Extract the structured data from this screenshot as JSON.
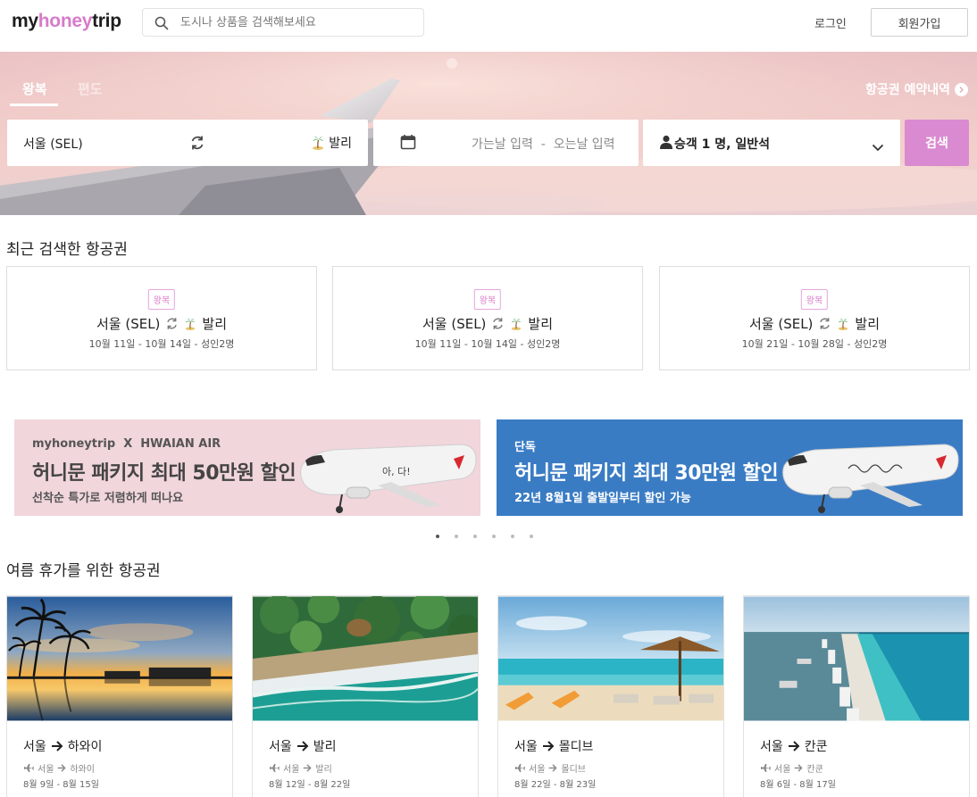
{
  "header": {
    "logo_my": "my",
    "logo_honey": "honey",
    "logo_trip": "trip",
    "search_placeholder": "도시나 상품을 검색해보세요",
    "login_label": "로그인",
    "signup_label": "회원가입"
  },
  "hero": {
    "tabs": [
      "왕복",
      "편도"
    ],
    "active_tab": "왕복",
    "booking_link_label": "항공권 예약내역",
    "origin": "서울 (SEL)",
    "destination": "발리",
    "date_placeholder": "가는날 입력  -  오는날 입력",
    "passengers": "승객 1 명, 일반석",
    "search_button": "검색",
    "search_button_color": "#d98ad0"
  },
  "recent": {
    "title": "최근 검색한 항공권",
    "cards": [
      {
        "badge": "왕복",
        "origin": "서울 (SEL)",
        "destination": "발리",
        "dates": "10월 11일 - 10월 14일 - 성인2명"
      },
      {
        "badge": "왕복",
        "origin": "서울 (SEL)",
        "destination": "발리",
        "dates": "10월 11일 - 10월 14일 - 성인2명"
      },
      {
        "badge": "왕복",
        "origin": "서울 (SEL)",
        "destination": "발리",
        "dates": "10월 21일 - 10월 28일 - 성인2명"
      }
    ]
  },
  "banners": [
    {
      "brand": "myhoneytrip  X  HWAIAN AIR",
      "title": "허니문 패키지 최대 50만원 할인",
      "subtitle": "선착순 특가로 저렴하게 떠나요",
      "color": "#f1d6dc"
    },
    {
      "brand": "단독",
      "title": "허니문 패키지 최대 30만원 할인",
      "subtitle": "22년 8월1일 출발일부터 할인 가능",
      "color": "#3a7cc4"
    }
  ],
  "carousel": {
    "dot_count": 6,
    "active_index": 0
  },
  "summer": {
    "title": "여름 휴가를 위한 항공권",
    "cards": [
      {
        "title_from": "서울",
        "title_to": "하와이",
        "sub_from": "서울",
        "sub_to": "하와이",
        "dates": "8월 9일 - 8월 15일",
        "photo": "hawaii-sunset-palms"
      },
      {
        "title_from": "서울",
        "title_to": "발리",
        "sub_from": "서울",
        "sub_to": "발리",
        "dates": "8월 12일 - 8월 22일",
        "photo": "bali-aerial-coast"
      },
      {
        "title_from": "서울",
        "title_to": "몰디브",
        "sub_from": "서울",
        "sub_to": "몰디브",
        "dates": "8월 22일 - 8월 23일",
        "photo": "maldives-beach-umbrella"
      },
      {
        "title_from": "서울",
        "title_to": "칸쿤",
        "sub_from": "서울",
        "sub_to": "칸쿤",
        "dates": "8월 6일 - 8월 17일",
        "photo": "cancun-aerial-coast"
      }
    ]
  }
}
